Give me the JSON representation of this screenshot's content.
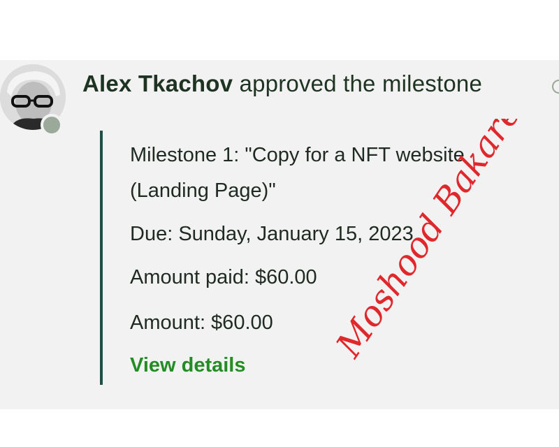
{
  "activity": {
    "actor": "Alex Tkachov",
    "action": "approved the milestone"
  },
  "milestone": {
    "title_line1": "Milestone 1: \"Copy for a NFT website",
    "title_line2": "(Landing Page)\"",
    "due": "Due: Sunday, January 15, 2023",
    "amount_paid": "Amount paid: $60.00",
    "amount": "Amount: $60.00",
    "view_details_label": "View details"
  },
  "watermark": {
    "text": "Moshood Bakare",
    "color": "#e0282c"
  },
  "icons": {
    "avatar": "user-avatar",
    "status": "online-status-dot",
    "time": "clock-icon"
  }
}
